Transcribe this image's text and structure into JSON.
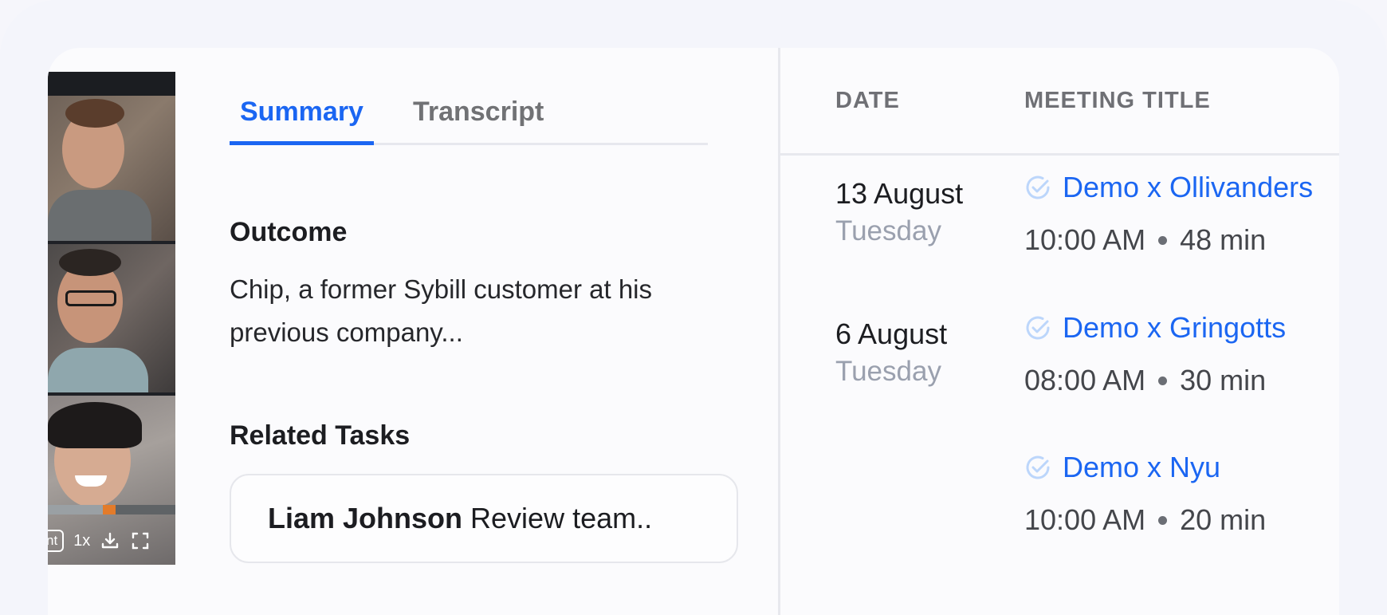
{
  "video": {
    "chip_label": "nt",
    "speed": "1x",
    "progress_fraction": 0.43
  },
  "tabs": [
    {
      "label": "Summary",
      "active": true
    },
    {
      "label": "Transcript",
      "active": false
    }
  ],
  "summary": {
    "outcome_title": "Outcome",
    "outcome_text": "Chip, a former Sybill customer at his previous company...",
    "tasks_title": "Related Tasks",
    "task": {
      "assignee": "Liam Johnson",
      "text": "Review team.."
    }
  },
  "meetings": {
    "headers": {
      "date": "DATE",
      "title": "MEETING TITLE"
    },
    "rows": [
      {
        "date": "13 August",
        "day": "Tuesday",
        "title": "Demo x Ollivanders",
        "time": "10:00 AM",
        "duration": "48 min"
      },
      {
        "date": "6 August",
        "day": "Tuesday",
        "title": "Demo x Gringotts",
        "time": "08:00 AM",
        "duration": "30 min"
      },
      {
        "date": "",
        "day": "",
        "title": "Demo x Nyu",
        "time": "10:00 AM",
        "duration": "20 min"
      }
    ]
  },
  "colors": {
    "accent": "#1b66f2",
    "check_icon": "#bcd6fb",
    "muted_day": "#9aa0ae"
  }
}
